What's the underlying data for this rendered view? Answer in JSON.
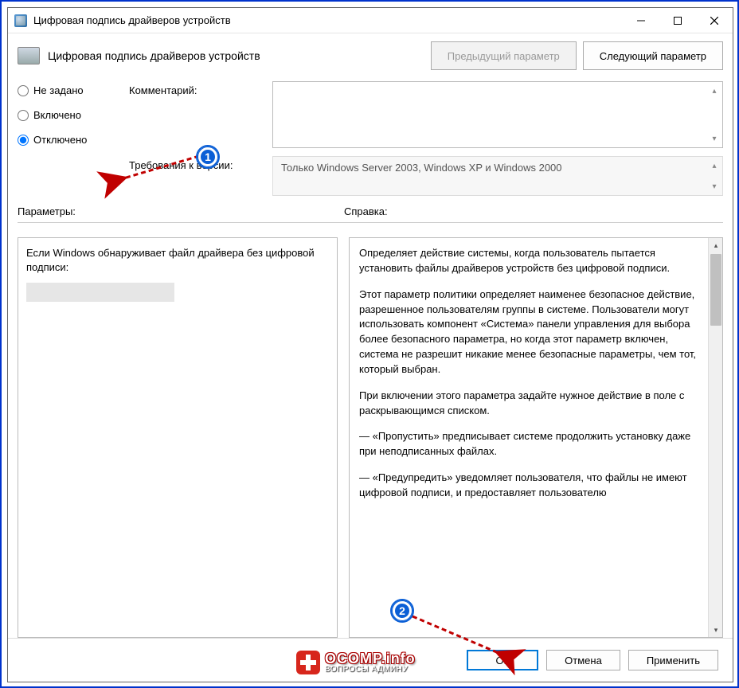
{
  "window": {
    "title": "Цифровая подпись драйверов устройств"
  },
  "header": {
    "title": "Цифровая подпись драйверов устройств",
    "prev": "Предыдущий параметр",
    "next": "Следующий параметр"
  },
  "radios": {
    "not_configured": "Не задано",
    "enabled": "Включено",
    "disabled": "Отключено"
  },
  "fields": {
    "comment_label": "Комментарий:",
    "version_label": "Требования к версии:",
    "version_value": "Только Windows Server 2003, Windows XP и Windows 2000"
  },
  "lower": {
    "options_label": "Параметры:",
    "help_label": "Справка:",
    "option_text": "Если Windows обнаруживает файл драйвера без цифровой подписи:",
    "help_p1": "Определяет действие системы, когда пользователь пытается установить файлы драйверов устройств без цифровой подписи.",
    "help_p2": "Этот параметр политики определяет наименее безопасное действие, разрешенное пользователям группы в системе. Пользователи могут использовать компонент «Система» панели управления для выбора более безопасного параметра, но когда этот параметр включен, система не разрешит никакие менее безопасные параметры, чем тот, который выбран.",
    "help_p3": "При включении этого параметра задайте нужное действие в поле с раскрывающимся списком.",
    "help_p4": "— «Пропустить» предписывает системе продолжить установку даже при неподписанных файлах.",
    "help_p5": "— «Предупредить» уведомляет пользователя, что файлы не имеют цифровой подписи, и предоставляет пользователю"
  },
  "footer": {
    "ok": "ОК",
    "cancel": "Отмена",
    "apply": "Применить"
  },
  "badges": {
    "one": "1",
    "two": "2"
  },
  "watermark": {
    "line1a": "OCOMP",
    "line1b": ".info",
    "line2": "ВОПРОСЫ АДМИНУ"
  }
}
